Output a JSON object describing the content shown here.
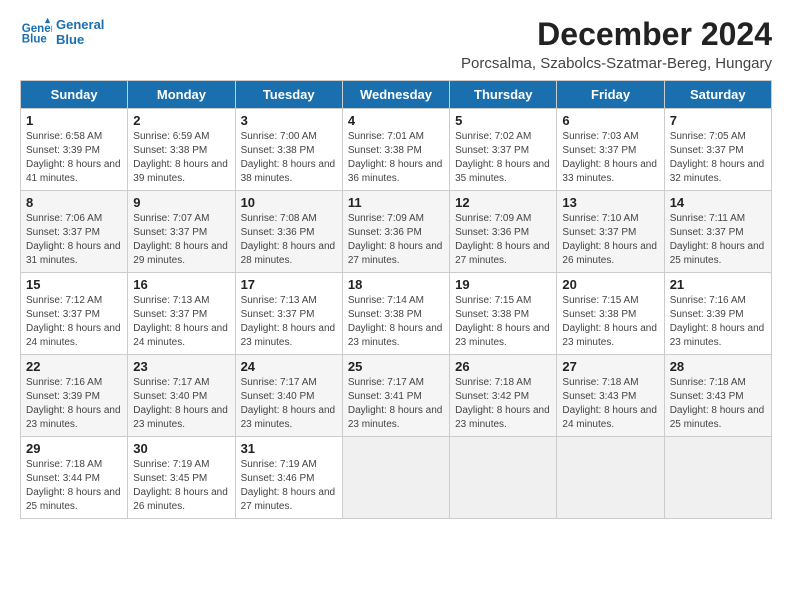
{
  "logo": {
    "line1": "General",
    "line2": "Blue"
  },
  "title": "December 2024",
  "subtitle": "Porcsalma, Szabolcs-Szatmar-Bereg, Hungary",
  "days_of_week": [
    "Sunday",
    "Monday",
    "Tuesday",
    "Wednesday",
    "Thursday",
    "Friday",
    "Saturday"
  ],
  "weeks": [
    [
      {
        "day": 1,
        "sunrise": "6:58 AM",
        "sunset": "3:39 PM",
        "daylight": "8 hours and 41 minutes."
      },
      {
        "day": 2,
        "sunrise": "6:59 AM",
        "sunset": "3:38 PM",
        "daylight": "8 hours and 39 minutes."
      },
      {
        "day": 3,
        "sunrise": "7:00 AM",
        "sunset": "3:38 PM",
        "daylight": "8 hours and 38 minutes."
      },
      {
        "day": 4,
        "sunrise": "7:01 AM",
        "sunset": "3:38 PM",
        "daylight": "8 hours and 36 minutes."
      },
      {
        "day": 5,
        "sunrise": "7:02 AM",
        "sunset": "3:37 PM",
        "daylight": "8 hours and 35 minutes."
      },
      {
        "day": 6,
        "sunrise": "7:03 AM",
        "sunset": "3:37 PM",
        "daylight": "8 hours and 33 minutes."
      },
      {
        "day": 7,
        "sunrise": "7:05 AM",
        "sunset": "3:37 PM",
        "daylight": "8 hours and 32 minutes."
      }
    ],
    [
      {
        "day": 8,
        "sunrise": "7:06 AM",
        "sunset": "3:37 PM",
        "daylight": "8 hours and 31 minutes."
      },
      {
        "day": 9,
        "sunrise": "7:07 AM",
        "sunset": "3:37 PM",
        "daylight": "8 hours and 29 minutes."
      },
      {
        "day": 10,
        "sunrise": "7:08 AM",
        "sunset": "3:36 PM",
        "daylight": "8 hours and 28 minutes."
      },
      {
        "day": 11,
        "sunrise": "7:09 AM",
        "sunset": "3:36 PM",
        "daylight": "8 hours and 27 minutes."
      },
      {
        "day": 12,
        "sunrise": "7:09 AM",
        "sunset": "3:36 PM",
        "daylight": "8 hours and 27 minutes."
      },
      {
        "day": 13,
        "sunrise": "7:10 AM",
        "sunset": "3:37 PM",
        "daylight": "8 hours and 26 minutes."
      },
      {
        "day": 14,
        "sunrise": "7:11 AM",
        "sunset": "3:37 PM",
        "daylight": "8 hours and 25 minutes."
      }
    ],
    [
      {
        "day": 15,
        "sunrise": "7:12 AM",
        "sunset": "3:37 PM",
        "daylight": "8 hours and 24 minutes."
      },
      {
        "day": 16,
        "sunrise": "7:13 AM",
        "sunset": "3:37 PM",
        "daylight": "8 hours and 24 minutes."
      },
      {
        "day": 17,
        "sunrise": "7:13 AM",
        "sunset": "3:37 PM",
        "daylight": "8 hours and 23 minutes."
      },
      {
        "day": 18,
        "sunrise": "7:14 AM",
        "sunset": "3:38 PM",
        "daylight": "8 hours and 23 minutes."
      },
      {
        "day": 19,
        "sunrise": "7:15 AM",
        "sunset": "3:38 PM",
        "daylight": "8 hours and 23 minutes."
      },
      {
        "day": 20,
        "sunrise": "7:15 AM",
        "sunset": "3:38 PM",
        "daylight": "8 hours and 23 minutes."
      },
      {
        "day": 21,
        "sunrise": "7:16 AM",
        "sunset": "3:39 PM",
        "daylight": "8 hours and 23 minutes."
      }
    ],
    [
      {
        "day": 22,
        "sunrise": "7:16 AM",
        "sunset": "3:39 PM",
        "daylight": "8 hours and 23 minutes."
      },
      {
        "day": 23,
        "sunrise": "7:17 AM",
        "sunset": "3:40 PM",
        "daylight": "8 hours and 23 minutes."
      },
      {
        "day": 24,
        "sunrise": "7:17 AM",
        "sunset": "3:40 PM",
        "daylight": "8 hours and 23 minutes."
      },
      {
        "day": 25,
        "sunrise": "7:17 AM",
        "sunset": "3:41 PM",
        "daylight": "8 hours and 23 minutes."
      },
      {
        "day": 26,
        "sunrise": "7:18 AM",
        "sunset": "3:42 PM",
        "daylight": "8 hours and 23 minutes."
      },
      {
        "day": 27,
        "sunrise": "7:18 AM",
        "sunset": "3:43 PM",
        "daylight": "8 hours and 24 minutes."
      },
      {
        "day": 28,
        "sunrise": "7:18 AM",
        "sunset": "3:43 PM",
        "daylight": "8 hours and 25 minutes."
      }
    ],
    [
      {
        "day": 29,
        "sunrise": "7:18 AM",
        "sunset": "3:44 PM",
        "daylight": "8 hours and 25 minutes."
      },
      {
        "day": 30,
        "sunrise": "7:19 AM",
        "sunset": "3:45 PM",
        "daylight": "8 hours and 26 minutes."
      },
      {
        "day": 31,
        "sunrise": "7:19 AM",
        "sunset": "3:46 PM",
        "daylight": "8 hours and 27 minutes."
      },
      null,
      null,
      null,
      null
    ]
  ]
}
